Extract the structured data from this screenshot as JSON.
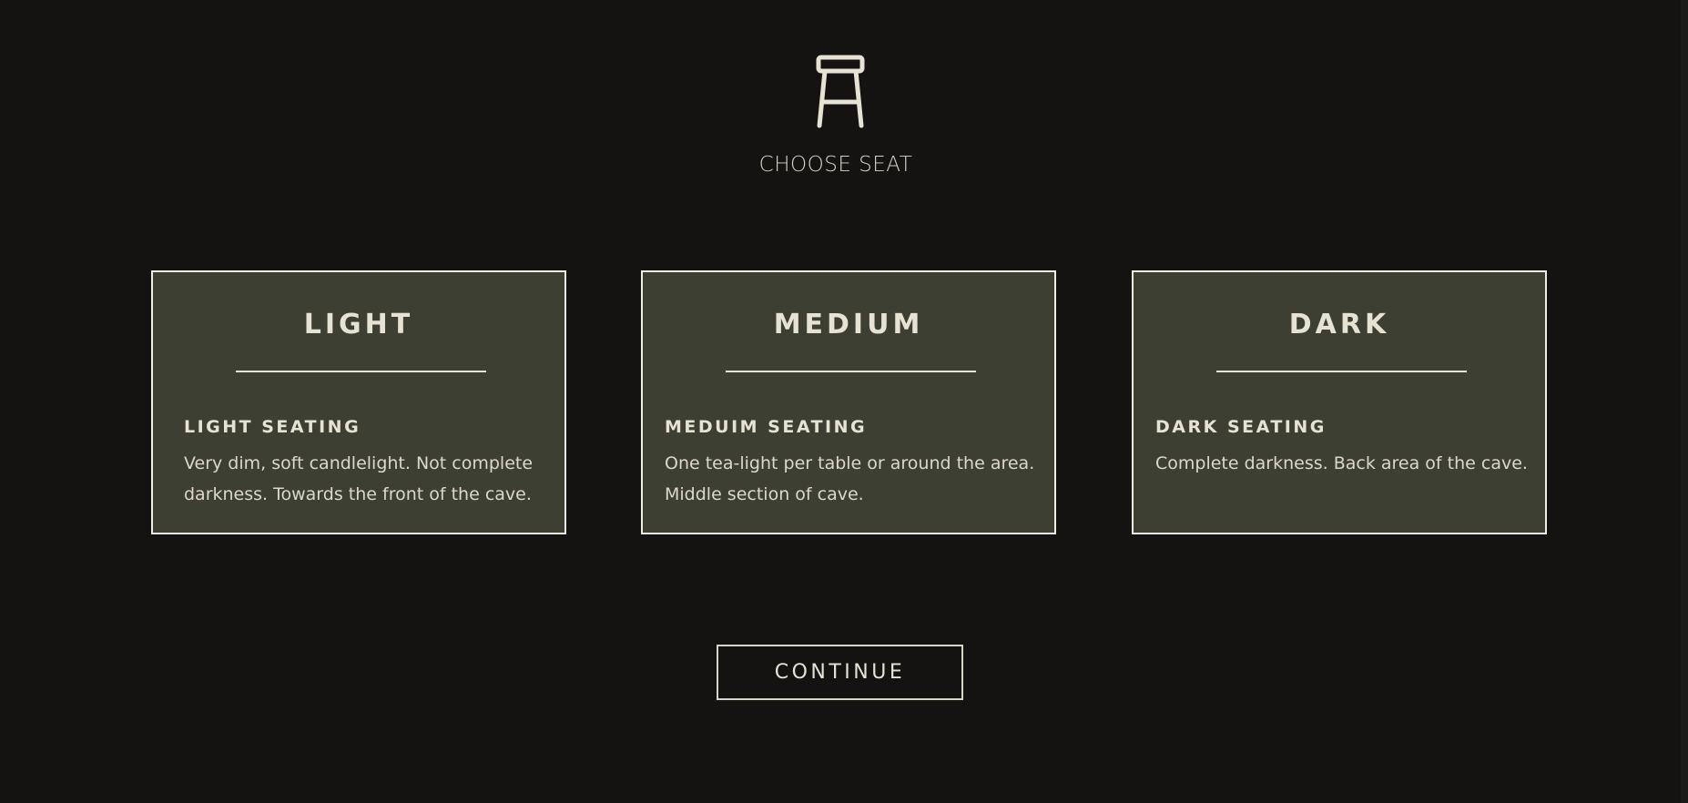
{
  "header": {
    "icon": "stool-icon",
    "title": "CHOOSE SEAT"
  },
  "options": [
    {
      "title": "LIGHT",
      "subtitle": "LIGHT SEATING",
      "description": "Very dim, soft candlelight. Not complete darkness. Towards the front of the cave."
    },
    {
      "title": "MEDIUM",
      "subtitle": "MEDUIM SEATING",
      "description": "One tea-light per table or around the area. Middle section of cave."
    },
    {
      "title": "DARK",
      "subtitle": "DARK SEATING",
      "description": "Complete darkness. Back area of the cave."
    }
  ],
  "actions": {
    "continue_label": "CONTINUE"
  },
  "colors": {
    "background": "#141311",
    "card_background": "#3e3f33",
    "card_border": "#f0ede2",
    "text": "#e6e2d4"
  }
}
